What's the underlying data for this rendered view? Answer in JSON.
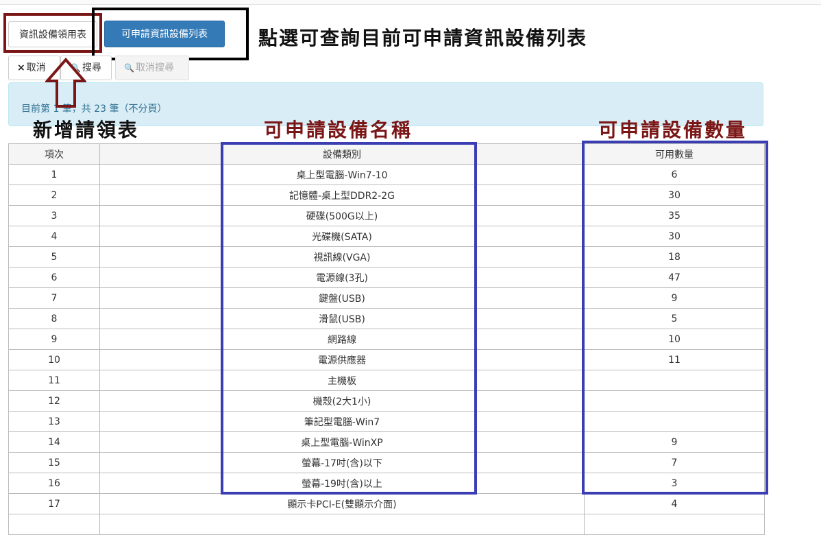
{
  "buttons": {
    "apply_form": "資訊設備領用表",
    "list_available": "可申請資訊設備列表"
  },
  "toolbar": {
    "cancel_icon": "×",
    "cancel_label": "取消",
    "search_icon": "🔍",
    "search_label": "搜尋",
    "clear_icon": "🔍",
    "clear_label": "取消搜尋"
  },
  "info": {
    "paging_text": "目前第 1 筆，共 23 筆（不分頁）"
  },
  "annotations": {
    "top_note": "點選可查詢目前可申請資訊設備列表",
    "new_form": "新增請領表",
    "name_col": "可申請設備名稱",
    "qty_col": "可申請設備數量"
  },
  "table": {
    "headers": [
      "項次",
      "設備類別",
      "可用數量"
    ],
    "rows": [
      {
        "no": "1",
        "name": "桌上型電腦-Win7-10",
        "qty": "6"
      },
      {
        "no": "2",
        "name": "記憶體-桌上型DDR2-2G",
        "qty": "30"
      },
      {
        "no": "3",
        "name": "硬碟(500G以上)",
        "qty": "35"
      },
      {
        "no": "4",
        "name": "光碟機(SATA)",
        "qty": "30"
      },
      {
        "no": "5",
        "name": "視訊線(VGA)",
        "qty": "18"
      },
      {
        "no": "6",
        "name": "電源線(3孔)",
        "qty": "47"
      },
      {
        "no": "7",
        "name": "鍵盤(USB)",
        "qty": "9"
      },
      {
        "no": "8",
        "name": "滑鼠(USB)",
        "qty": "5"
      },
      {
        "no": "9",
        "name": "網路線",
        "qty": "10"
      },
      {
        "no": "10",
        "name": "電源供應器",
        "qty": "11"
      },
      {
        "no": "11",
        "name": "主機板",
        "qty": ""
      },
      {
        "no": "12",
        "name": "機殼(2大1小)",
        "qty": ""
      },
      {
        "no": "13",
        "name": "筆記型電腦-Win7",
        "qty": ""
      },
      {
        "no": "14",
        "name": "桌上型電腦-WinXP",
        "qty": "9"
      },
      {
        "no": "15",
        "name": "螢幕-17吋(含)以下",
        "qty": "7"
      },
      {
        "no": "16",
        "name": "螢幕-19吋(含)以上",
        "qty": "3"
      },
      {
        "no": "17",
        "name": "顯示卡PCI-E(雙顯示介面)",
        "qty": "4"
      },
      {
        "no": "",
        "name": "",
        "qty": ""
      }
    ]
  }
}
